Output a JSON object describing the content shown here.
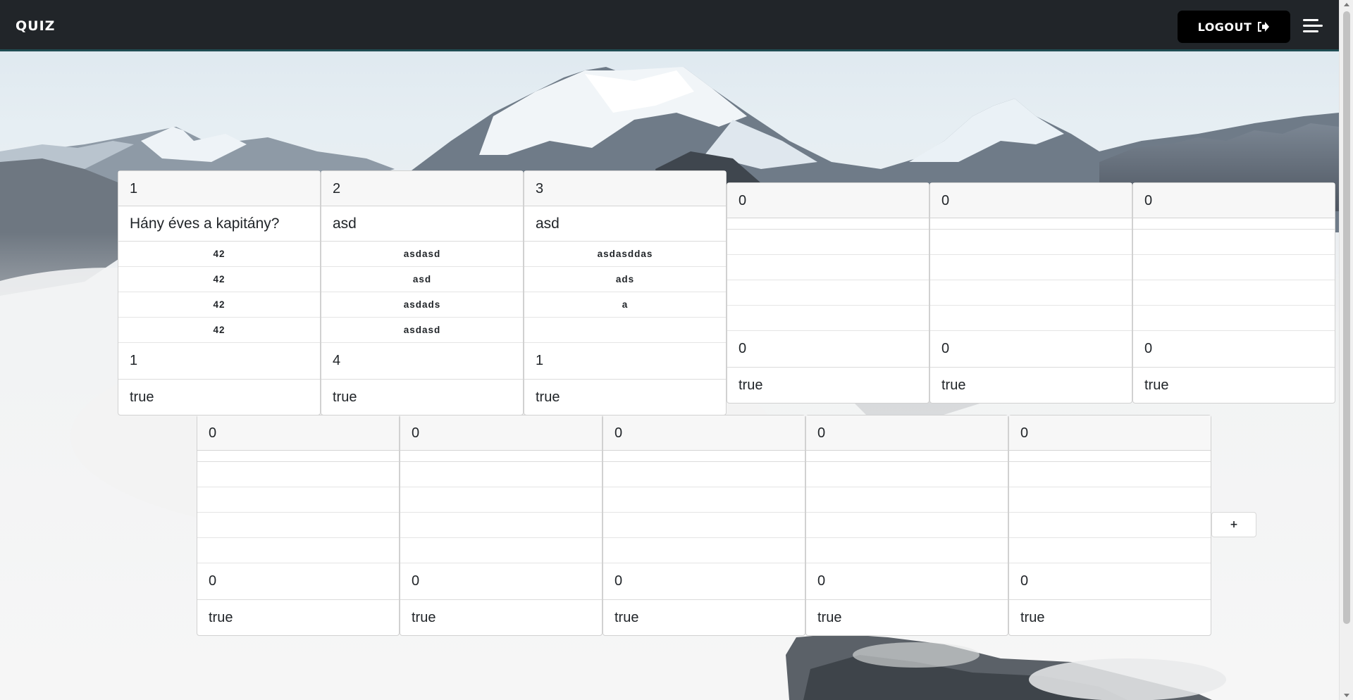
{
  "navbar": {
    "brand": "QUIZ",
    "logout_label": "LOGOUT",
    "logout_icon": "logout-arrow-icon",
    "menu_icon": "hamburger-menu-icon"
  },
  "cards_row1": [
    {
      "number": "1",
      "question": "Hány éves a kapitány?",
      "answers": [
        "42",
        "42",
        "42",
        "42"
      ],
      "correct": "1",
      "active": "true"
    },
    {
      "number": "2",
      "question": "asd",
      "answers": [
        "asdasd",
        "asd",
        "asdads",
        "asdasd"
      ],
      "correct": "4",
      "active": "true"
    },
    {
      "number": "3",
      "question": "asd",
      "answers": [
        "asdasddas",
        "ads",
        "a",
        ""
      ],
      "correct": "1",
      "active": "true"
    },
    {
      "number": "0",
      "question": "",
      "answers": [
        "",
        "",
        "",
        ""
      ],
      "correct": "0",
      "active": "true"
    },
    {
      "number": "0",
      "question": "",
      "answers": [
        "",
        "",
        "",
        ""
      ],
      "correct": "0",
      "active": "true"
    },
    {
      "number": "0",
      "question": "",
      "answers": [
        "",
        "",
        "",
        ""
      ],
      "correct": "0",
      "active": "true"
    }
  ],
  "cards_row2": [
    {
      "number": "0",
      "question": "",
      "answers": [
        "",
        "",
        "",
        ""
      ],
      "correct": "0",
      "active": "true"
    },
    {
      "number": "0",
      "question": "",
      "answers": [
        "",
        "",
        "",
        ""
      ],
      "correct": "0",
      "active": "true"
    },
    {
      "number": "0",
      "question": "",
      "answers": [
        "",
        "",
        "",
        ""
      ],
      "correct": "0",
      "active": "true"
    },
    {
      "number": "0",
      "question": "",
      "answers": [
        "",
        "",
        "",
        ""
      ],
      "correct": "0",
      "active": "true"
    },
    {
      "number": "0",
      "question": "",
      "answers": [
        "",
        "",
        "",
        ""
      ],
      "correct": "0",
      "active": "true"
    }
  ],
  "add_button_label": "+",
  "colors": {
    "navbar_bg": "#212529",
    "logout_bg": "#000000",
    "card_header_bg": "#f7f7f7"
  }
}
